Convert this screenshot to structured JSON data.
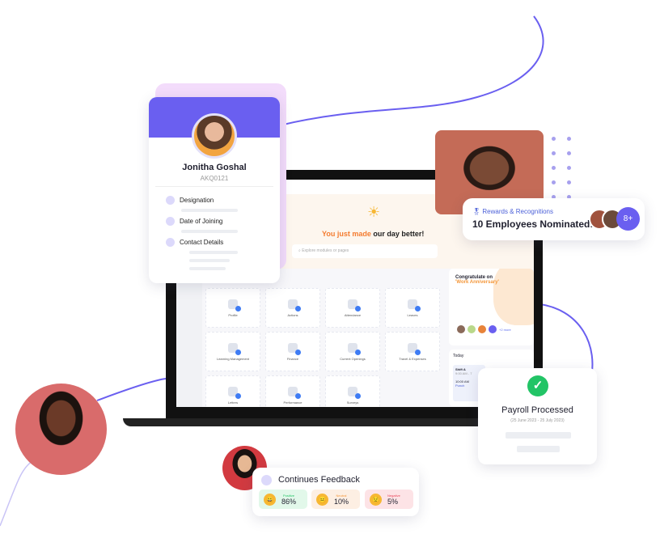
{
  "profile_card": {
    "name": "Jonitha Goshal",
    "employee_id": "AKQ0121",
    "fields": [
      "Designation",
      "Date of Joining",
      "Contact Details"
    ]
  },
  "dashboard": {
    "headline_highlight": "You just made",
    "headline_rest": "our day better!",
    "search_placeholder": "Explore modules or pages",
    "tiles": [
      "Profile",
      "Actions",
      "Attendance",
      "Leaves",
      "Learning Management",
      "Finance",
      "Current Openings",
      "Travel & Expenses",
      "Letters",
      "Performance",
      "Surveys"
    ],
    "congrats": {
      "title": "Congratulate on",
      "occasion": "'Work Anniversary'",
      "more": "+2 more"
    },
    "today": {
      "label": "Today",
      "shift": "Shift A",
      "shift_time": "9:00 AM - 7",
      "clock": "10:00 AM",
      "punch": "Punch"
    }
  },
  "rewards": {
    "label": "Rewards & Recognitions",
    "text": "10 Employees Nominated!",
    "count": "8+"
  },
  "payroll": {
    "title": "Payroll Processed",
    "period": "(25 June 2023 - 25 July 2023)"
  },
  "feedback": {
    "title": "Continues Feedback",
    "items": [
      {
        "label": "Positive",
        "value": "86%",
        "color": "#22c466"
      },
      {
        "label": "Neutral",
        "value": "10%",
        "color": "#f4973a"
      },
      {
        "label": "Negative",
        "value": "5%",
        "color": "#e8465a"
      }
    ]
  },
  "colors": {
    "accent": "#6a5ff0",
    "success": "#22c466",
    "highlight": "#f47c30"
  }
}
